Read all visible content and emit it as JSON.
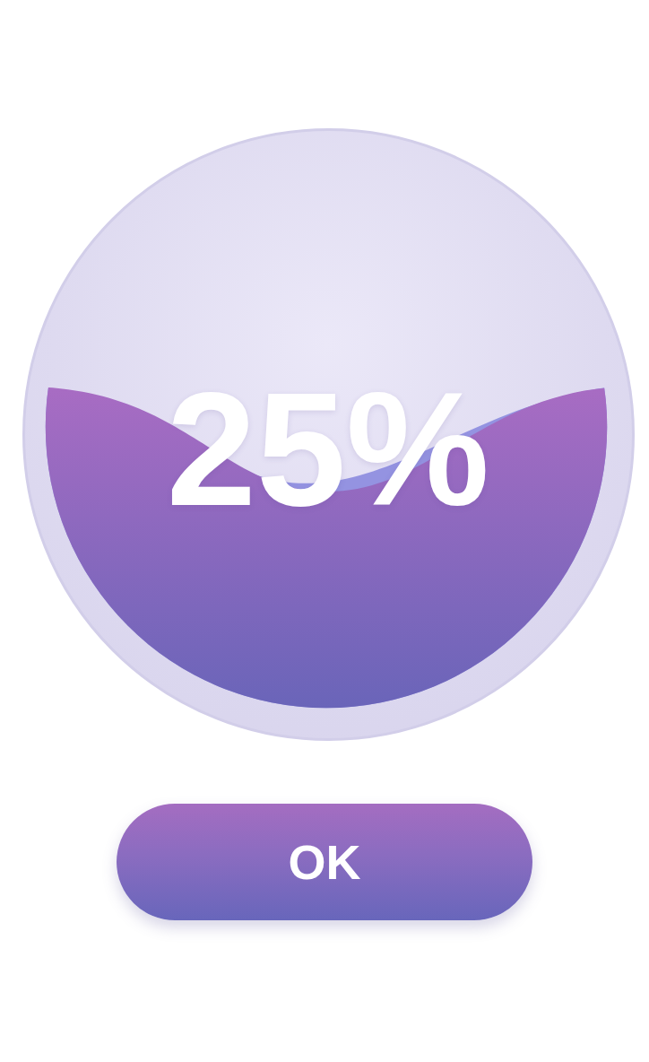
{
  "gauge": {
    "reading": "25%",
    "level": 0.48
  },
  "buttons": [
    "OK"
  ]
}
